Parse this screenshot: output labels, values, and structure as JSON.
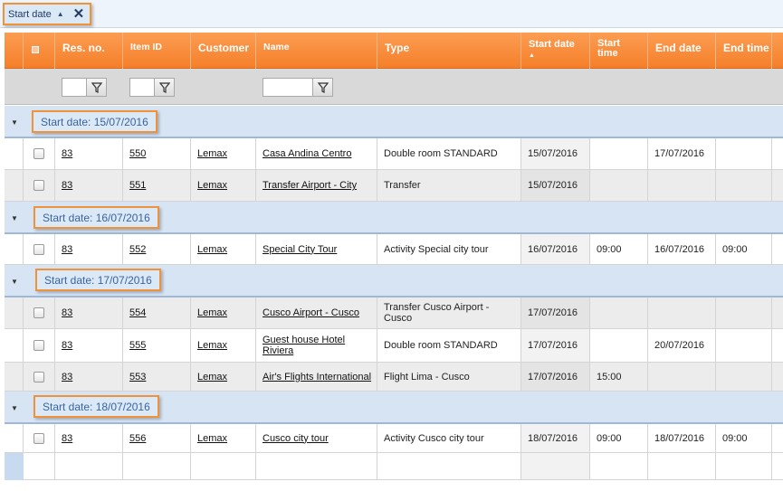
{
  "group_by": {
    "label": "Start date",
    "sort_arrow": "▲",
    "close": "✕"
  },
  "columns": {
    "select_all": "",
    "res_no": "Res. no.",
    "item_id": "Item ID",
    "customer": "Customer",
    "name": "Name",
    "type": "Type",
    "start_date": "Start date",
    "start_date_sort": "▲",
    "start_time": "Start time",
    "end_date": "End date",
    "end_time": "End time"
  },
  "filter_icon": "funnel-icon",
  "groups": [
    {
      "label": "Start date: 15/07/2016",
      "rows": [
        {
          "res": "83",
          "item": "550",
          "customer": "Lemax",
          "name": "Casa Andina Centro",
          "type": "Double room STANDARD",
          "start_date": "15/07/2016",
          "start_time": "",
          "end_date": "17/07/2016",
          "end_time": ""
        },
        {
          "res": "83",
          "item": "551",
          "customer": "Lemax",
          "name": "Transfer Airport - City",
          "type": "Transfer",
          "start_date": "15/07/2016",
          "start_time": "",
          "end_date": "",
          "end_time": ""
        }
      ]
    },
    {
      "label": "Start date: 16/07/2016",
      "rows": [
        {
          "res": "83",
          "item": "552",
          "customer": "Lemax",
          "name": "Special City Tour",
          "type": "Activity Special city tour",
          "start_date": "16/07/2016",
          "start_time": "09:00",
          "end_date": "16/07/2016",
          "end_time": "09:00"
        }
      ]
    },
    {
      "label": "Start date: 17/07/2016",
      "rows": [
        {
          "res": "83",
          "item": "554",
          "customer": "Lemax",
          "name": "Cusco Airport - Cusco",
          "type": "Transfer Cusco Airport - Cusco",
          "start_date": "17/07/2016",
          "start_time": "",
          "end_date": "",
          "end_time": ""
        },
        {
          "res": "83",
          "item": "555",
          "customer": "Lemax",
          "name": "Guest house Hotel Riviera",
          "type": "Double room STANDARD",
          "start_date": "17/07/2016",
          "start_time": "",
          "end_date": "20/07/2016",
          "end_time": ""
        },
        {
          "res": "83",
          "item": "553",
          "customer": "Lemax",
          "name": "Air's Flights International",
          "type": "Flight Lima - Cusco",
          "start_date": "17/07/2016",
          "start_time": "15:00",
          "end_date": "",
          "end_time": ""
        }
      ]
    },
    {
      "label": "Start date: 18/07/2016",
      "rows": [
        {
          "res": "83",
          "item": "556",
          "customer": "Lemax",
          "name": "Cusco city tour",
          "type": "Activity Cusco city tour",
          "start_date": "18/07/2016",
          "start_time": "09:00",
          "end_date": "18/07/2016",
          "end_time": "09:00"
        }
      ]
    }
  ],
  "colors": {
    "header_orange": "#f68a36",
    "group_blue": "#d6e4f4",
    "highlight_border": "#f0923a"
  }
}
